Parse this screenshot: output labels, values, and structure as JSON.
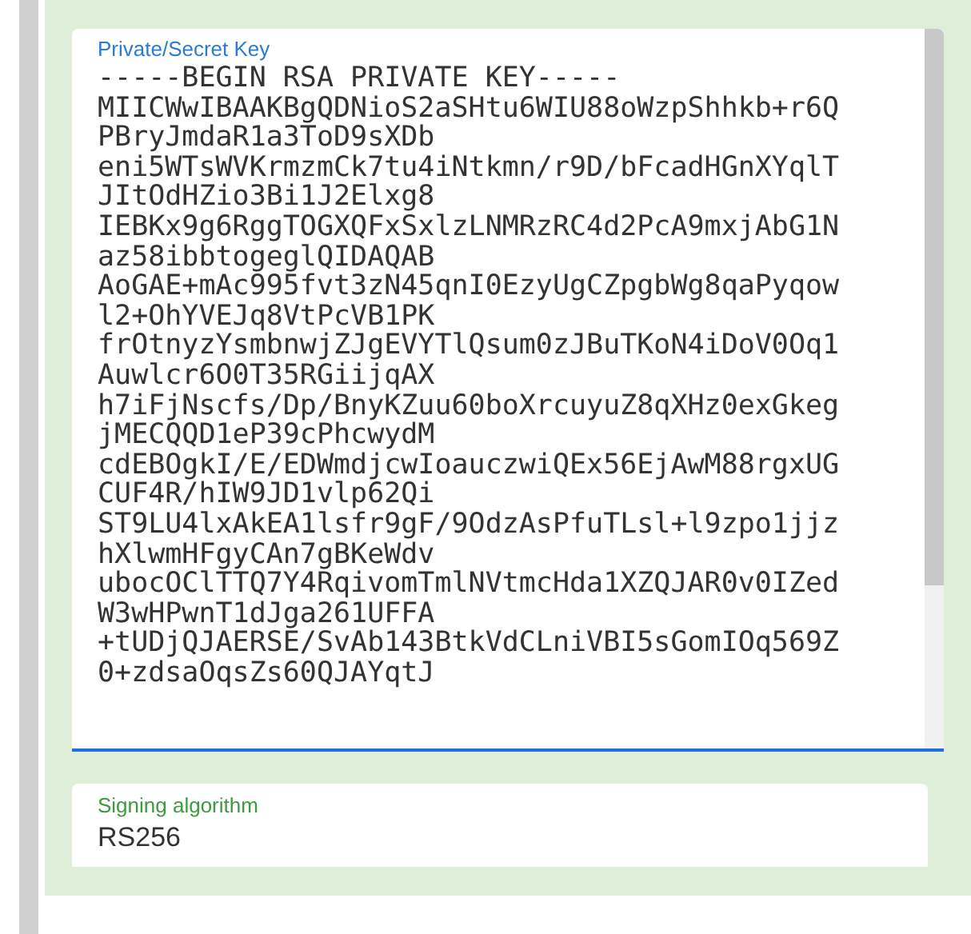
{
  "private_key": {
    "label": "Private/Secret Key",
    "lines": [
      "-----BEGIN RSA PRIVATE KEY-----",
      "MIICWwIBAAKBgQDNioS2aSHtu6WIU88oWzpShhkb+r6Q",
      "PBryJmdaR1a3ToD9sXDb",
      "eni5WTsWVKrmzmCk7tu4iNtkmn/r9D/bFcadHGnXYqlT",
      "JItOdHZio3Bi1J2Elxg8",
      "IEBKx9g6RggTOGXQFxSxlzLNMRzRC4d2PcA9mxjAbG1N",
      "az58ibbtogeglQIDAQAB",
      "AoGAE+mAc995fvt3zN45qnI0EzyUgCZpgbWg8qaPyqow",
      "l2+OhYVEJq8VtPcVB1PK",
      "frOtnyzYsmbnwjZJgEVYTlQsum0zJBuTKoN4iDoV0Oq1",
      "Auwlcr6O0T35RGiijqAX",
      "h7iFjNscfs/Dp/BnyKZuu60boXrcuyuZ8qXHz0exGkeg",
      "jMECQQD1eP39cPhcwydM",
      "cdEBOgkI/E/EDWmdjcwIoauczwiQEx56EjAwM88rgxUG",
      "CUF4R/hIW9JD1vlp62Qi",
      "ST9LU4lxAkEA1lsfr9gF/9OdzAsPfuTLsl+l9zpo1jjz",
      "hXlwmHFgyCAn7gBKeWdv",
      "ubocOClTTQ7Y4RqivomTmlNVtmcHda1XZQJAR0v0IZed",
      "W3wHPwnT1dJga261UFFA",
      "+tUDjQJAERSE/SvAb143BtkVdCLniVBI5sGomIOq569Z",
      "0+zdsaOqsZs60QJAYqtJ"
    ]
  },
  "signing_algorithm": {
    "label": "Signing algorithm",
    "value": "RS256"
  }
}
